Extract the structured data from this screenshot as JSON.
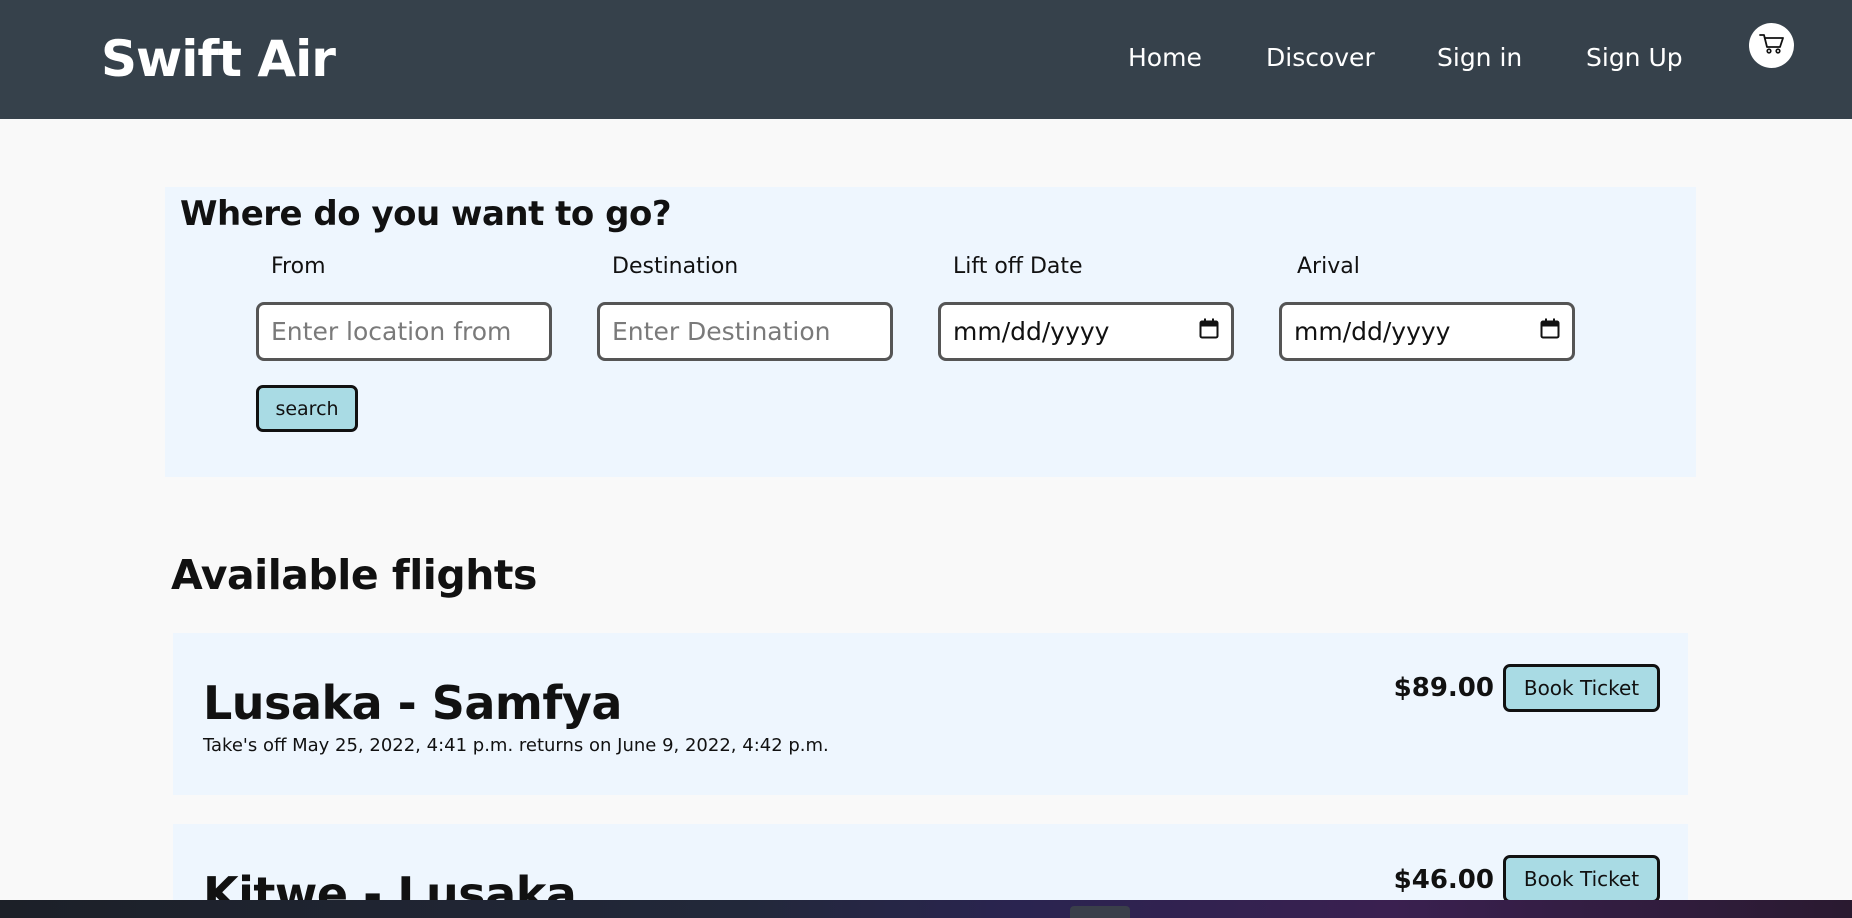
{
  "header": {
    "brand": "Swift Air",
    "nav": [
      "Home",
      "Discover",
      "Sign in",
      "Sign Up"
    ],
    "cart_icon": "cart-icon"
  },
  "search": {
    "title": "Where do you want to go?",
    "from_label": "From",
    "from_placeholder": "Enter location from",
    "destination_label": "Destination",
    "destination_placeholder": "Enter Destination",
    "liftoff_label": "Lift off Date",
    "liftoff_value": "mm/dd/yyyy",
    "arrival_label": "Arival",
    "arrival_value": "mm/dd/yyyy",
    "button": "search",
    "calendar_icon": "calendar-icon"
  },
  "flights": {
    "title": "Available flights",
    "items": [
      {
        "route": "Lusaka - Samfya",
        "schedule": "Take's off May 25, 2022, 4:41 p.m. returns on June 9, 2022, 4:42 p.m.",
        "price": "$89.00",
        "button": "Book Ticket"
      },
      {
        "route": "Kitwe - Lusaka",
        "price": "$46.00",
        "button": "Book Ticket"
      }
    ]
  },
  "colors": {
    "navbar": "#36414b",
    "panel": "#eef6fe",
    "button": "#a9dbe4",
    "page": "#f9f9f9"
  }
}
